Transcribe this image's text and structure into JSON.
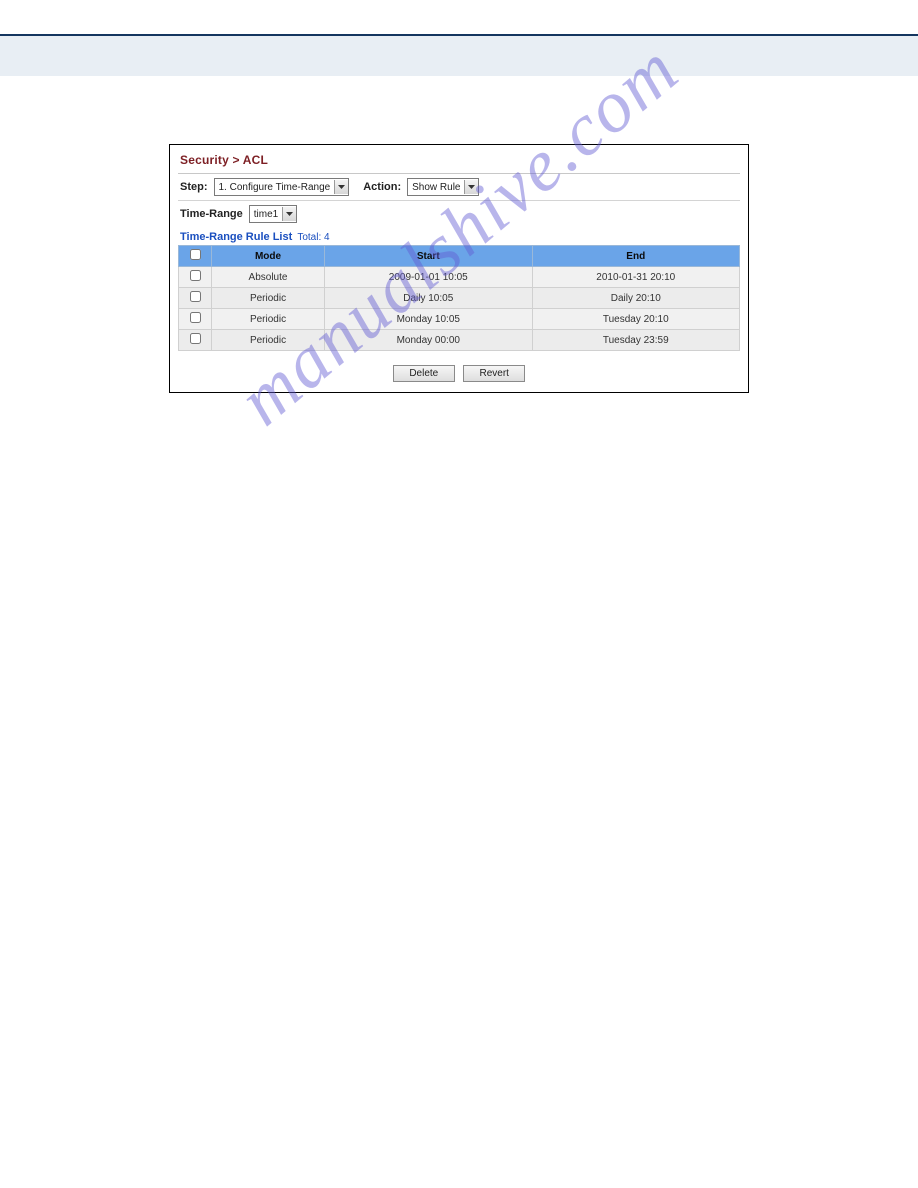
{
  "watermark": "manualshive.com",
  "breadcrumb": "Security > ACL",
  "controls": {
    "step_label": "Step:",
    "step_value": "1. Configure Time-Range",
    "action_label": "Action:",
    "action_value": "Show Rule",
    "time_range_label": "Time-Range",
    "time_range_value": "time1"
  },
  "list_title": "Time-Range Rule List",
  "list_total_label": "Total: 4",
  "columns": {
    "mode": "Mode",
    "start": "Start",
    "end": "End"
  },
  "rows": [
    {
      "mode": "Absolute",
      "start": "2009-01-01 10:05",
      "end": "2010-01-31 20:10"
    },
    {
      "mode": "Periodic",
      "start": "Daily 10:05",
      "end": "Daily 20:10"
    },
    {
      "mode": "Periodic",
      "start": "Monday 10:05",
      "end": "Tuesday 20:10"
    },
    {
      "mode": "Periodic",
      "start": "Monday 00:00",
      "end": "Tuesday 23:59"
    }
  ],
  "buttons": {
    "delete": "Delete",
    "revert": "Revert"
  }
}
